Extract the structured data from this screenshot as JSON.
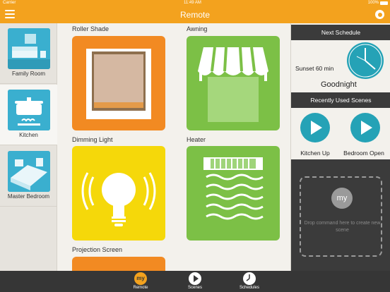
{
  "status": {
    "carrier": "Carrier",
    "time": "11:49 AM",
    "battery": "100%"
  },
  "nav": {
    "title": "Remote"
  },
  "rooms": [
    {
      "label": "Family Room"
    },
    {
      "label": "Kitchen"
    },
    {
      "label": "Master Bedroom"
    }
  ],
  "devices": [
    {
      "label": "Roller Shade"
    },
    {
      "label": "Awning"
    },
    {
      "label": "Dimming Light"
    },
    {
      "label": "Heater"
    },
    {
      "label": "Projection Screen"
    }
  ],
  "schedule": {
    "header": "Next Schedule",
    "event": "Sunset 60 min",
    "scene": "Goodnight"
  },
  "recent": {
    "header": "Recently Used Scenes",
    "scenes": [
      {
        "label": "Kitchen Up"
      },
      {
        "label": "Bedroom Open"
      }
    ]
  },
  "dropzone": {
    "badge": "my",
    "text": "Drop command here to create new scene"
  },
  "tabs": [
    {
      "label": "Remote",
      "badge": "my"
    },
    {
      "label": "Scenes"
    },
    {
      "label": "Schedules"
    }
  ],
  "colors": {
    "accent": "#f3a21e",
    "teal": "#25a2b6",
    "orange_tile": "#f28a22",
    "green_tile": "#7cc046",
    "yellow_tile": "#f5d80a",
    "dark": "#3b3b3b"
  }
}
